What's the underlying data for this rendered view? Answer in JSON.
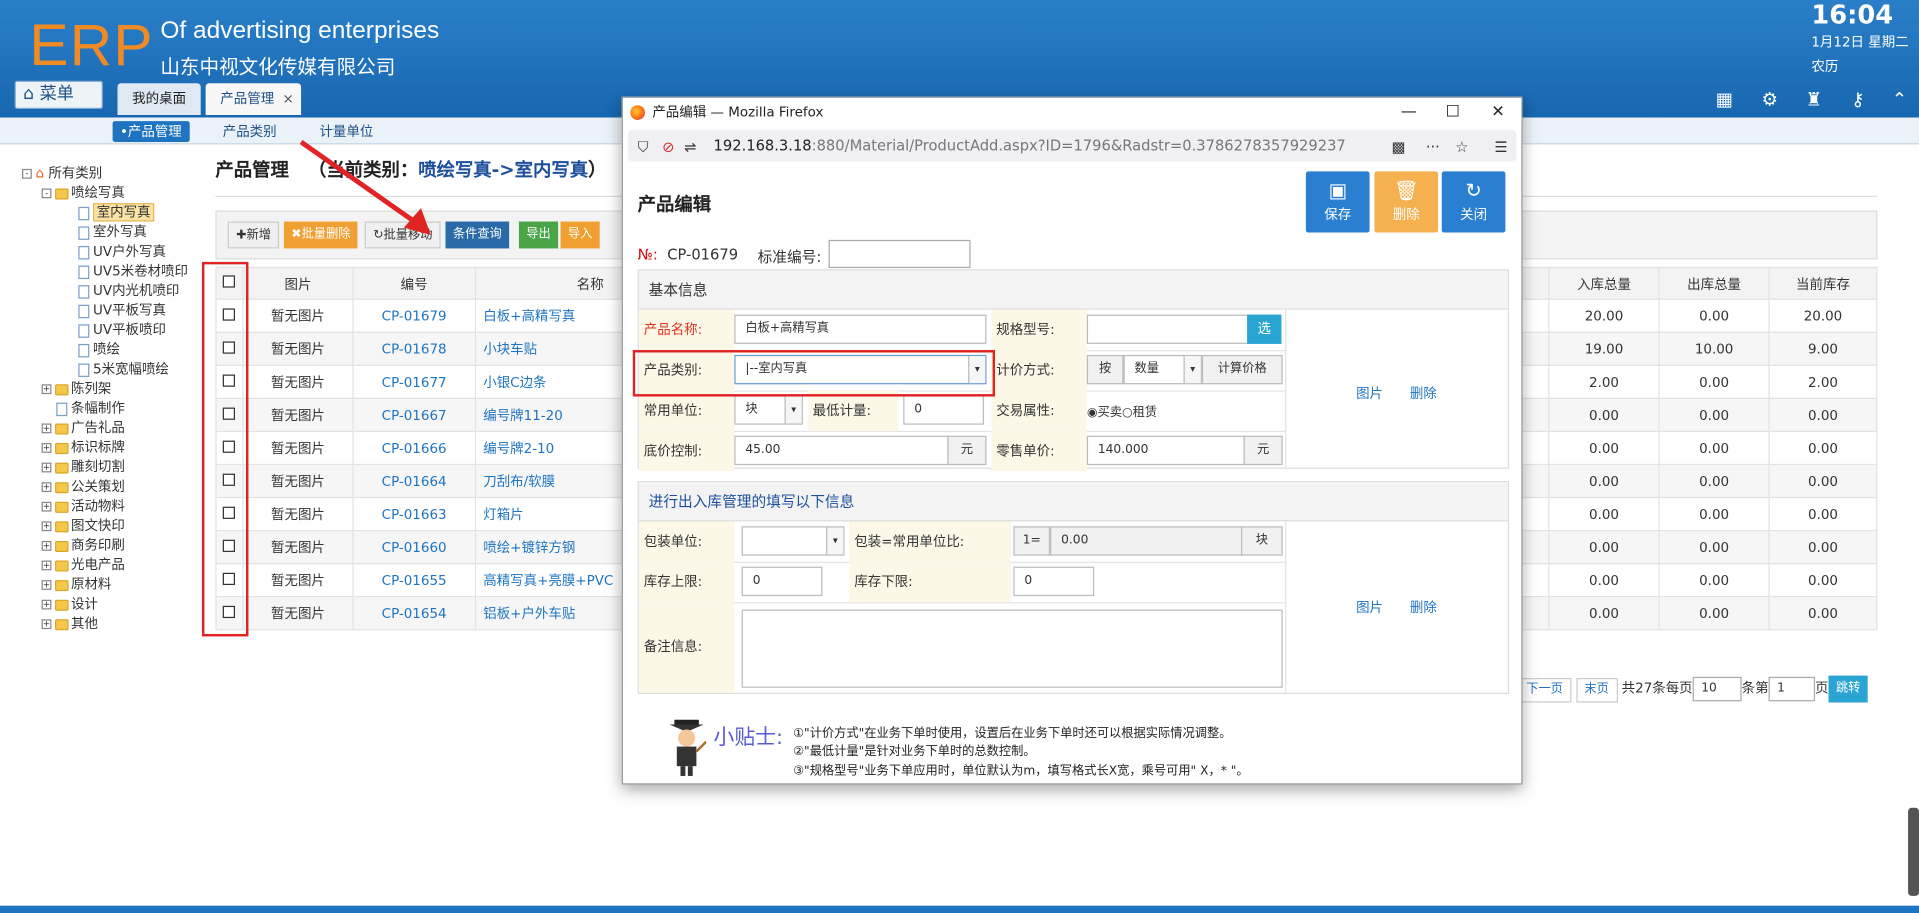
{
  "header": {
    "logo": "ERP",
    "slogan": "Of advertising enterprises",
    "company": "山东中视文化传媒有限公司",
    "clock": "16:04",
    "date": "1月12日 星期二",
    "lunar": "农历",
    "menu_label": "菜单",
    "tabs": [
      {
        "label": "我的桌面"
      },
      {
        "label": "产品管理"
      }
    ],
    "tab_close": "×"
  },
  "subnav": [
    "•产品管理",
    "产品类别",
    "计量单位"
  ],
  "tree": {
    "root": "所有类别",
    "nodes": [
      "喷绘写真",
      "室内写真",
      "室外写真",
      "UV户外写真",
      "UV5米卷材喷印",
      "UV内光机喷印",
      "UV平板写真",
      "UV平板喷印",
      "喷绘",
      "5米宽幅喷绘",
      "陈列架",
      "条幅制作",
      "广告礼品",
      "标识标牌",
      "雕刻切割",
      "公关策划",
      "活动物料",
      "图文快印",
      "商务印刷",
      "光电产品",
      "原材料",
      "设计",
      "其他"
    ]
  },
  "page": {
    "title": "产品管理",
    "current_prefix": "（当前类别：",
    "current_cat": "喷绘写真->室内写真",
    "current_suffix": "）"
  },
  "toolbar": {
    "add": "✚新增",
    "batch_delete": "✖批量删除",
    "batch_move": "↻批量移动",
    "query": "条件查询",
    "export": "导出",
    "import": "导入"
  },
  "grid": {
    "headers": [
      "图片",
      "编号",
      "名称",
      "入库总量",
      "出库总量",
      "当前库存"
    ],
    "rows": [
      {
        "img": "暂无图片",
        "code": "CP-01679",
        "name": "白板+高精写真",
        "in": "20.00",
        "out": "0.00",
        "stock": "20.00"
      },
      {
        "img": "暂无图片",
        "code": "CP-01678",
        "name": "小块车贴",
        "in": "19.00",
        "out": "10.00",
        "stock": "9.00"
      },
      {
        "img": "暂无图片",
        "code": "CP-01677",
        "name": "小银C边条",
        "in": "2.00",
        "out": "0.00",
        "stock": "2.00"
      },
      {
        "img": "暂无图片",
        "code": "CP-01667",
        "name": "编号牌11-20",
        "in": "0.00",
        "out": "0.00",
        "stock": "0.00"
      },
      {
        "img": "暂无图片",
        "code": "CP-01666",
        "name": "编号牌2-10",
        "in": "0.00",
        "out": "0.00",
        "stock": "0.00"
      },
      {
        "img": "暂无图片",
        "code": "CP-01664",
        "name": "刀刮布/软膜",
        "in": "0.00",
        "out": "0.00",
        "stock": "0.00"
      },
      {
        "img": "暂无图片",
        "code": "CP-01663",
        "name": "灯箱片",
        "in": "0.00",
        "out": "0.00",
        "stock": "0.00"
      },
      {
        "img": "暂无图片",
        "code": "CP-01660",
        "name": "喷绘+镀锌方钢",
        "in": "0.00",
        "out": "0.00",
        "stock": "0.00"
      },
      {
        "img": "暂无图片",
        "code": "CP-01655",
        "name": "高精写真+亮膜+PVC",
        "in": "0.00",
        "out": "0.00",
        "stock": "0.00"
      },
      {
        "img": "暂无图片",
        "code": "CP-01654",
        "name": "铝板+户外车贴",
        "in": "0.00",
        "out": "0.00",
        "stock": "0.00"
      }
    ]
  },
  "pager": {
    "next": "下一页",
    "last": "末页",
    "total_text": "共27条每页",
    "page_size": "10",
    "items_text": "条第",
    "page": "1",
    "page_text": "页",
    "go": "跳转"
  },
  "popup": {
    "window_title": "产品编辑 — Mozilla Firefox",
    "url_host": "192.168.3.18",
    "url_rest": ":880/Material/ProductAdd.aspx?ID=1796&Radstr=0.3786278357929237",
    "form_title": "产品编辑",
    "actions": {
      "save": "保存",
      "delete": "删除",
      "close": "关闭"
    },
    "no_label": "№:",
    "no_value": "CP-01679",
    "std_no_label": "标准编号:",
    "basic_header": "基本信息",
    "fields": {
      "name_label": "产品名称:",
      "name_value": "白板+高精写真",
      "spec_label": "规格型号:",
      "spec_btn": "选",
      "cat_label": "产品类别:",
      "cat_value": "|--室内写真",
      "price_mode_label": "计价方式:",
      "price_mode_by": "按",
      "price_mode_value": "数量",
      "price_mode_suffix": "计算价格",
      "unit_label": "常用单位:",
      "unit_value": "块",
      "min_label": "最低计量:",
      "min_value": "0",
      "trade_label": "交易属性:",
      "trade_options": "◉买卖○租赁",
      "floor_label": "底价控制:",
      "floor_value": "45.00",
      "floor_unit": "元",
      "retail_label": "零售单价:",
      "retail_value": "140.000",
      "retail_unit": "元",
      "pic_link": "图片",
      "del_link": "删除"
    },
    "stock_header": "进行出入库管理的填写以下信息",
    "stock": {
      "pack_label": "包装单位:",
      "ratio_label": "包装=常用单位比:",
      "ratio_prefix": "1=",
      "ratio_value": "0.00",
      "ratio_unit": "块",
      "upper_label": "库存上限:",
      "upper_value": "0",
      "lower_label": "库存下限:",
      "lower_value": "0",
      "remark_label": "备注信息:",
      "pic_link": "图片",
      "del_link": "删除"
    },
    "tips": {
      "title": "小贴士:",
      "lines": [
        "①\"计价方式\"在业务下单时使用，设置后在业务下单时还可以根据实际情况调整。",
        "②\"最低计量\"是针对业务下单时的总数控制。",
        "③\"规格型号\"业务下单应用时，单位默认为m，填写格式长X宽，乘号可用\" X，* \"。"
      ]
    }
  },
  "colors": {
    "header_blue": "#1f74c1",
    "logo_orange": "#f08a24",
    "highlight_red": "#e02424",
    "link_blue": "#1f74c1"
  }
}
